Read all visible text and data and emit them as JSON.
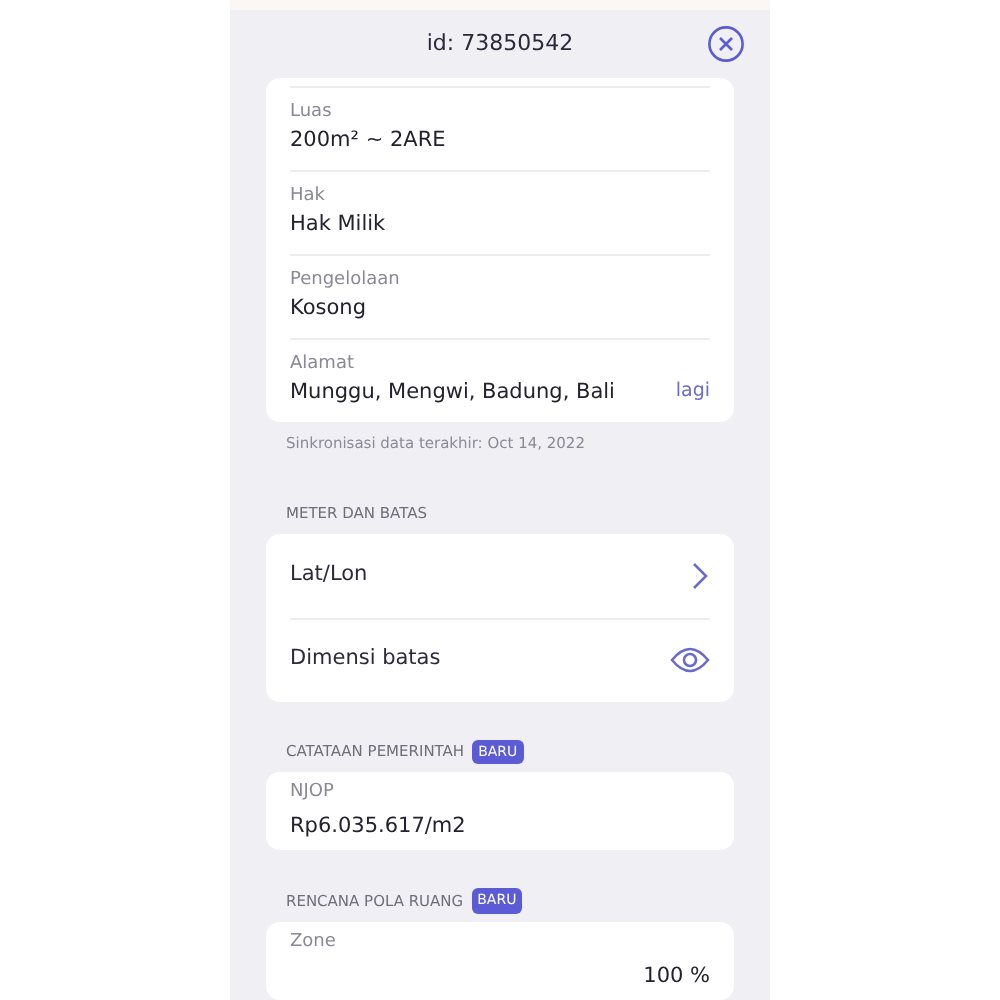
{
  "header": {
    "title": "id: 73850542"
  },
  "details": [
    {
      "label": "Luas",
      "value": "200m² ~ 2ARE"
    },
    {
      "label": "Hak",
      "value": "Hak Milik"
    },
    {
      "label": "Pengelolaan",
      "value": "Kosong"
    },
    {
      "label": "Alamat",
      "value": "Munggu, Mengwi, Badung, Bali",
      "link": "lagi"
    }
  ],
  "sync_note": "Sinkronisasi data terakhir: Oct 14, 2022",
  "sections": [
    {
      "title": "METER DAN BATAS",
      "rows": [
        {
          "kind": "nav",
          "label": "Lat/Lon"
        },
        {
          "kind": "view",
          "label": "Dimensi batas"
        }
      ]
    },
    {
      "title": "CATATAAN PEMERINTAH",
      "badge": "BARU",
      "fields": [
        {
          "kind": "amount",
          "label": "NJOP",
          "value": "Rp6.035.617/m2"
        }
      ]
    },
    {
      "title": "RENCANA POLA RUANG",
      "badge": "BARU",
      "fields": [
        {
          "kind": "share",
          "label": "Zone",
          "value": "100 %"
        }
      ]
    }
  ]
}
